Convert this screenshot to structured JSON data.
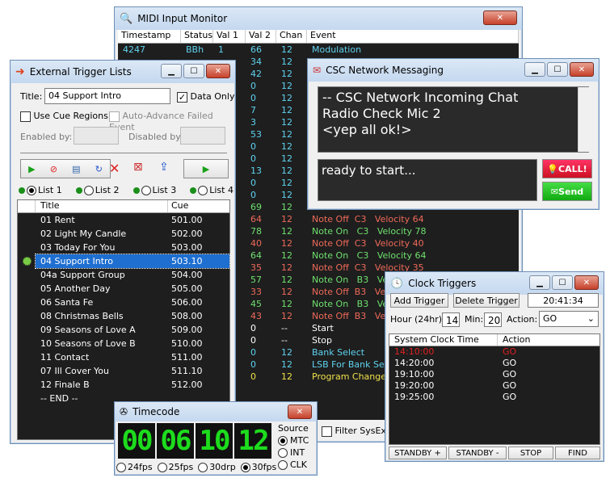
{
  "midi": {
    "title": "MIDI Input Monitor",
    "headers": [
      "Timestamp",
      "Status",
      "Val 1",
      "Val 2",
      "Chan",
      "Event"
    ],
    "rows": [
      {
        "ts": "4247",
        "st": "BBh",
        "v1": "1",
        "v2": "66",
        "ch": "12",
        "ev": "Modulation",
        "c": "#5fd3f0"
      },
      {
        "ts": "",
        "st": "",
        "v1": "",
        "v2": "34",
        "ch": "12",
        "ev": "",
        "c": "#5fd3f0"
      },
      {
        "ts": "",
        "st": "",
        "v1": "",
        "v2": "42",
        "ch": "12",
        "ev": "",
        "c": "#5fd3f0"
      },
      {
        "ts": "",
        "st": "",
        "v1": "",
        "v2": "0",
        "ch": "12",
        "ev": "",
        "c": "#5fd3f0"
      },
      {
        "ts": "",
        "st": "",
        "v1": "",
        "v2": "0",
        "ch": "12",
        "ev": "",
        "c": "#5fd3f0"
      },
      {
        "ts": "",
        "st": "",
        "v1": "",
        "v2": "7",
        "ch": "12",
        "ev": "",
        "c": "#5fd3f0"
      },
      {
        "ts": "",
        "st": "",
        "v1": "",
        "v2": "3",
        "ch": "12",
        "ev": "",
        "c": "#5fd3f0"
      },
      {
        "ts": "",
        "st": "",
        "v1": "",
        "v2": "53",
        "ch": "12",
        "ev": "",
        "c": "#5fd3f0"
      },
      {
        "ts": "",
        "st": "",
        "v1": "",
        "v2": "0",
        "ch": "12",
        "ev": "",
        "c": "#5fd3f0"
      },
      {
        "ts": "",
        "st": "",
        "v1": "",
        "v2": "0",
        "ch": "12",
        "ev": "",
        "c": "#5fd3f0"
      },
      {
        "ts": "",
        "st": "",
        "v1": "",
        "v2": "13",
        "ch": "12",
        "ev": "",
        "c": "#5fd3f0"
      },
      {
        "ts": "",
        "st": "",
        "v1": "",
        "v2": "0",
        "ch": "12",
        "ev": "",
        "c": "#5fd3f0"
      },
      {
        "ts": "",
        "st": "",
        "v1": "",
        "v2": "0",
        "ch": "12",
        "ev": "",
        "c": "#5fd3f0"
      },
      {
        "ts": "",
        "st": "",
        "v1": "",
        "v2": "69",
        "ch": "12",
        "ev": "",
        "c": "#6ee06e"
      },
      {
        "ts": "",
        "st": "",
        "v1": "",
        "v2": "64",
        "ch": "12",
        "ev": "Note Off  C3   Velocity 64",
        "c": "#ef6a5a"
      },
      {
        "ts": "",
        "st": "",
        "v1": "",
        "v2": "78",
        "ch": "12",
        "ev": "Note On   C3   Velocity 78",
        "c": "#6ee06e"
      },
      {
        "ts": "",
        "st": "",
        "v1": "",
        "v2": "40",
        "ch": "12",
        "ev": "Note Off  C3   Velocity 40",
        "c": "#ef6a5a"
      },
      {
        "ts": "",
        "st": "",
        "v1": "",
        "v2": "64",
        "ch": "12",
        "ev": "Note On   C3   Velocity 64",
        "c": "#6ee06e"
      },
      {
        "ts": "",
        "st": "",
        "v1": "",
        "v2": "35",
        "ch": "12",
        "ev": "Note Off  C3   Velocity 35",
        "c": "#ef6a5a"
      },
      {
        "ts": "",
        "st": "",
        "v1": "",
        "v2": "57",
        "ch": "12",
        "ev": "Note On   B3   Velo",
        "c": "#6ee06e"
      },
      {
        "ts": "",
        "st": "",
        "v1": "",
        "v2": "33",
        "ch": "12",
        "ev": "Note Off  B3   Velo",
        "c": "#ef6a5a"
      },
      {
        "ts": "",
        "st": "",
        "v1": "",
        "v2": "45",
        "ch": "12",
        "ev": "Note On   B3   Velo",
        "c": "#6ee06e"
      },
      {
        "ts": "",
        "st": "",
        "v1": "",
        "v2": "43",
        "ch": "12",
        "ev": "Note Off  B3   Velo",
        "c": "#ef6a5a"
      },
      {
        "ts": "",
        "st": "",
        "v1": "",
        "v2": "0",
        "ch": "--",
        "ev": "Start",
        "c": "#ffffff"
      },
      {
        "ts": "",
        "st": "",
        "v1": "",
        "v2": "0",
        "ch": "--",
        "ev": "Stop",
        "c": "#ffffff"
      },
      {
        "ts": "",
        "st": "",
        "v1": "",
        "v2": "0",
        "ch": "12",
        "ev": "Bank Select",
        "c": "#5fd3f0"
      },
      {
        "ts": "",
        "st": "",
        "v1": "",
        "v2": "0",
        "ch": "12",
        "ev": "LSB For Bank Sele",
        "c": "#5fd3f0"
      },
      {
        "ts": "",
        "st": "",
        "v1": "",
        "v2": "0",
        "ch": "12",
        "ev": "Program Change",
        "c": "#f0e04a"
      }
    ],
    "filter_label": "Filter SysEx"
  },
  "ext": {
    "title": "External Trigger Lists",
    "title_label": "Title:",
    "title_value": "04 Support Intro",
    "data_only": "Data Only",
    "use_cue": "Use Cue Regions",
    "auto_adv": "Auto-Advance Failed Event",
    "enabled_by": "Enabled by:",
    "disabled_by": "Disabled by:",
    "lists": [
      "List 1",
      "List 2",
      "List 3",
      "List 4"
    ],
    "col_title": "Title",
    "col_cue": "Cue",
    "rows": [
      {
        "t": "01 Rent",
        "c": "501.00"
      },
      {
        "t": "02 Light My Candle",
        "c": "502.00"
      },
      {
        "t": "03 Today For You",
        "c": "503.00"
      },
      {
        "t": "04 Support Intro",
        "c": "503.10"
      },
      {
        "t": "04a Support Group",
        "c": "504.00"
      },
      {
        "t": "05 Another Day",
        "c": "505.00"
      },
      {
        "t": "06 Santa Fe",
        "c": "506.00"
      },
      {
        "t": "08 Christmas Bells",
        "c": "508.00"
      },
      {
        "t": "09 Seasons of Love A",
        "c": "509.00"
      },
      {
        "t": "10 Seasons of Love B",
        "c": "510.00"
      },
      {
        "t": "11 Contact",
        "c": "511.00"
      },
      {
        "t": "07 Ill Cover You",
        "c": "511.10"
      },
      {
        "t": "12 Finale B",
        "c": "512.00"
      },
      {
        "t": "-- END --",
        "c": ""
      }
    ]
  },
  "csc": {
    "title": "CSC Network Messaging",
    "chat": [
      "-- CSC Network Incoming Chat",
      "Radio Check Mic 2",
      "<yep all ok!>"
    ],
    "input": "ready to start...",
    "call": "CALL!",
    "send": "Send"
  },
  "clock": {
    "title": "Clock Triggers",
    "add": "Add Trigger",
    "del": "Delete Trigger",
    "time": "20:41:34",
    "hour_label": "Hour (24hr):",
    "hour": "14",
    "min_label": "Min:",
    "min": "20",
    "action_label": "Action:",
    "action": "GO",
    "col_time": "System Clock Time",
    "col_action": "Action",
    "rows": [
      {
        "t": "14:10:00",
        "a": "GO",
        "c": "#e02020"
      },
      {
        "t": "14:20:00",
        "a": "GO",
        "c": "#ffffff"
      },
      {
        "t": "19:10:00",
        "a": "GO",
        "c": "#ffffff"
      },
      {
        "t": "19:20:00",
        "a": "GO",
        "c": "#ffffff"
      },
      {
        "t": "19:25:00",
        "a": "GO",
        "c": "#ffffff"
      }
    ],
    "buttons": [
      "STANDBY +",
      "STANDBY -",
      "STOP",
      "FIND"
    ]
  },
  "tc": {
    "title": "Timecode",
    "digits": [
      "00",
      "06",
      "10",
      "12"
    ],
    "source": "Source",
    "sources": [
      "MTC",
      "INT",
      "CLK"
    ],
    "fps": [
      "24fps",
      "25fps",
      "30drp",
      "30fps"
    ]
  }
}
